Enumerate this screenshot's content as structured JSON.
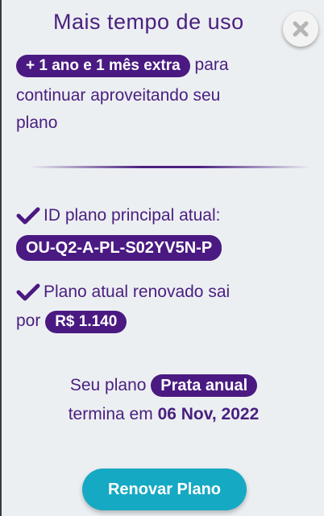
{
  "header": {
    "title": "Mais tempo de uso",
    "close_icon": "close-icon"
  },
  "offer": {
    "badge": "+ 1 ano e 1 mês extra",
    "text_after_badge": "para",
    "text_line2": "continuar aproveitando seu",
    "text_line3": "plano"
  },
  "plan_id": {
    "label": "ID plano principal atual:",
    "value": "OU-Q2-A-PL-S02YV5N-P"
  },
  "renewal": {
    "label_line1": "Plano atual renovado sai",
    "label_line2": "por",
    "price": "R$ 1.140"
  },
  "expiry": {
    "label": "Seu plano",
    "plan_name": "Prata anual",
    "ends_label": "termina em",
    "end_date": "06 Nov, 2022"
  },
  "actions": {
    "renew_label": "Renovar Plano"
  },
  "colors": {
    "text": "#4a2080",
    "pill_bg": "#4a1a82",
    "button_bg": "#16a9c3",
    "page_bg": "#eceff2"
  }
}
